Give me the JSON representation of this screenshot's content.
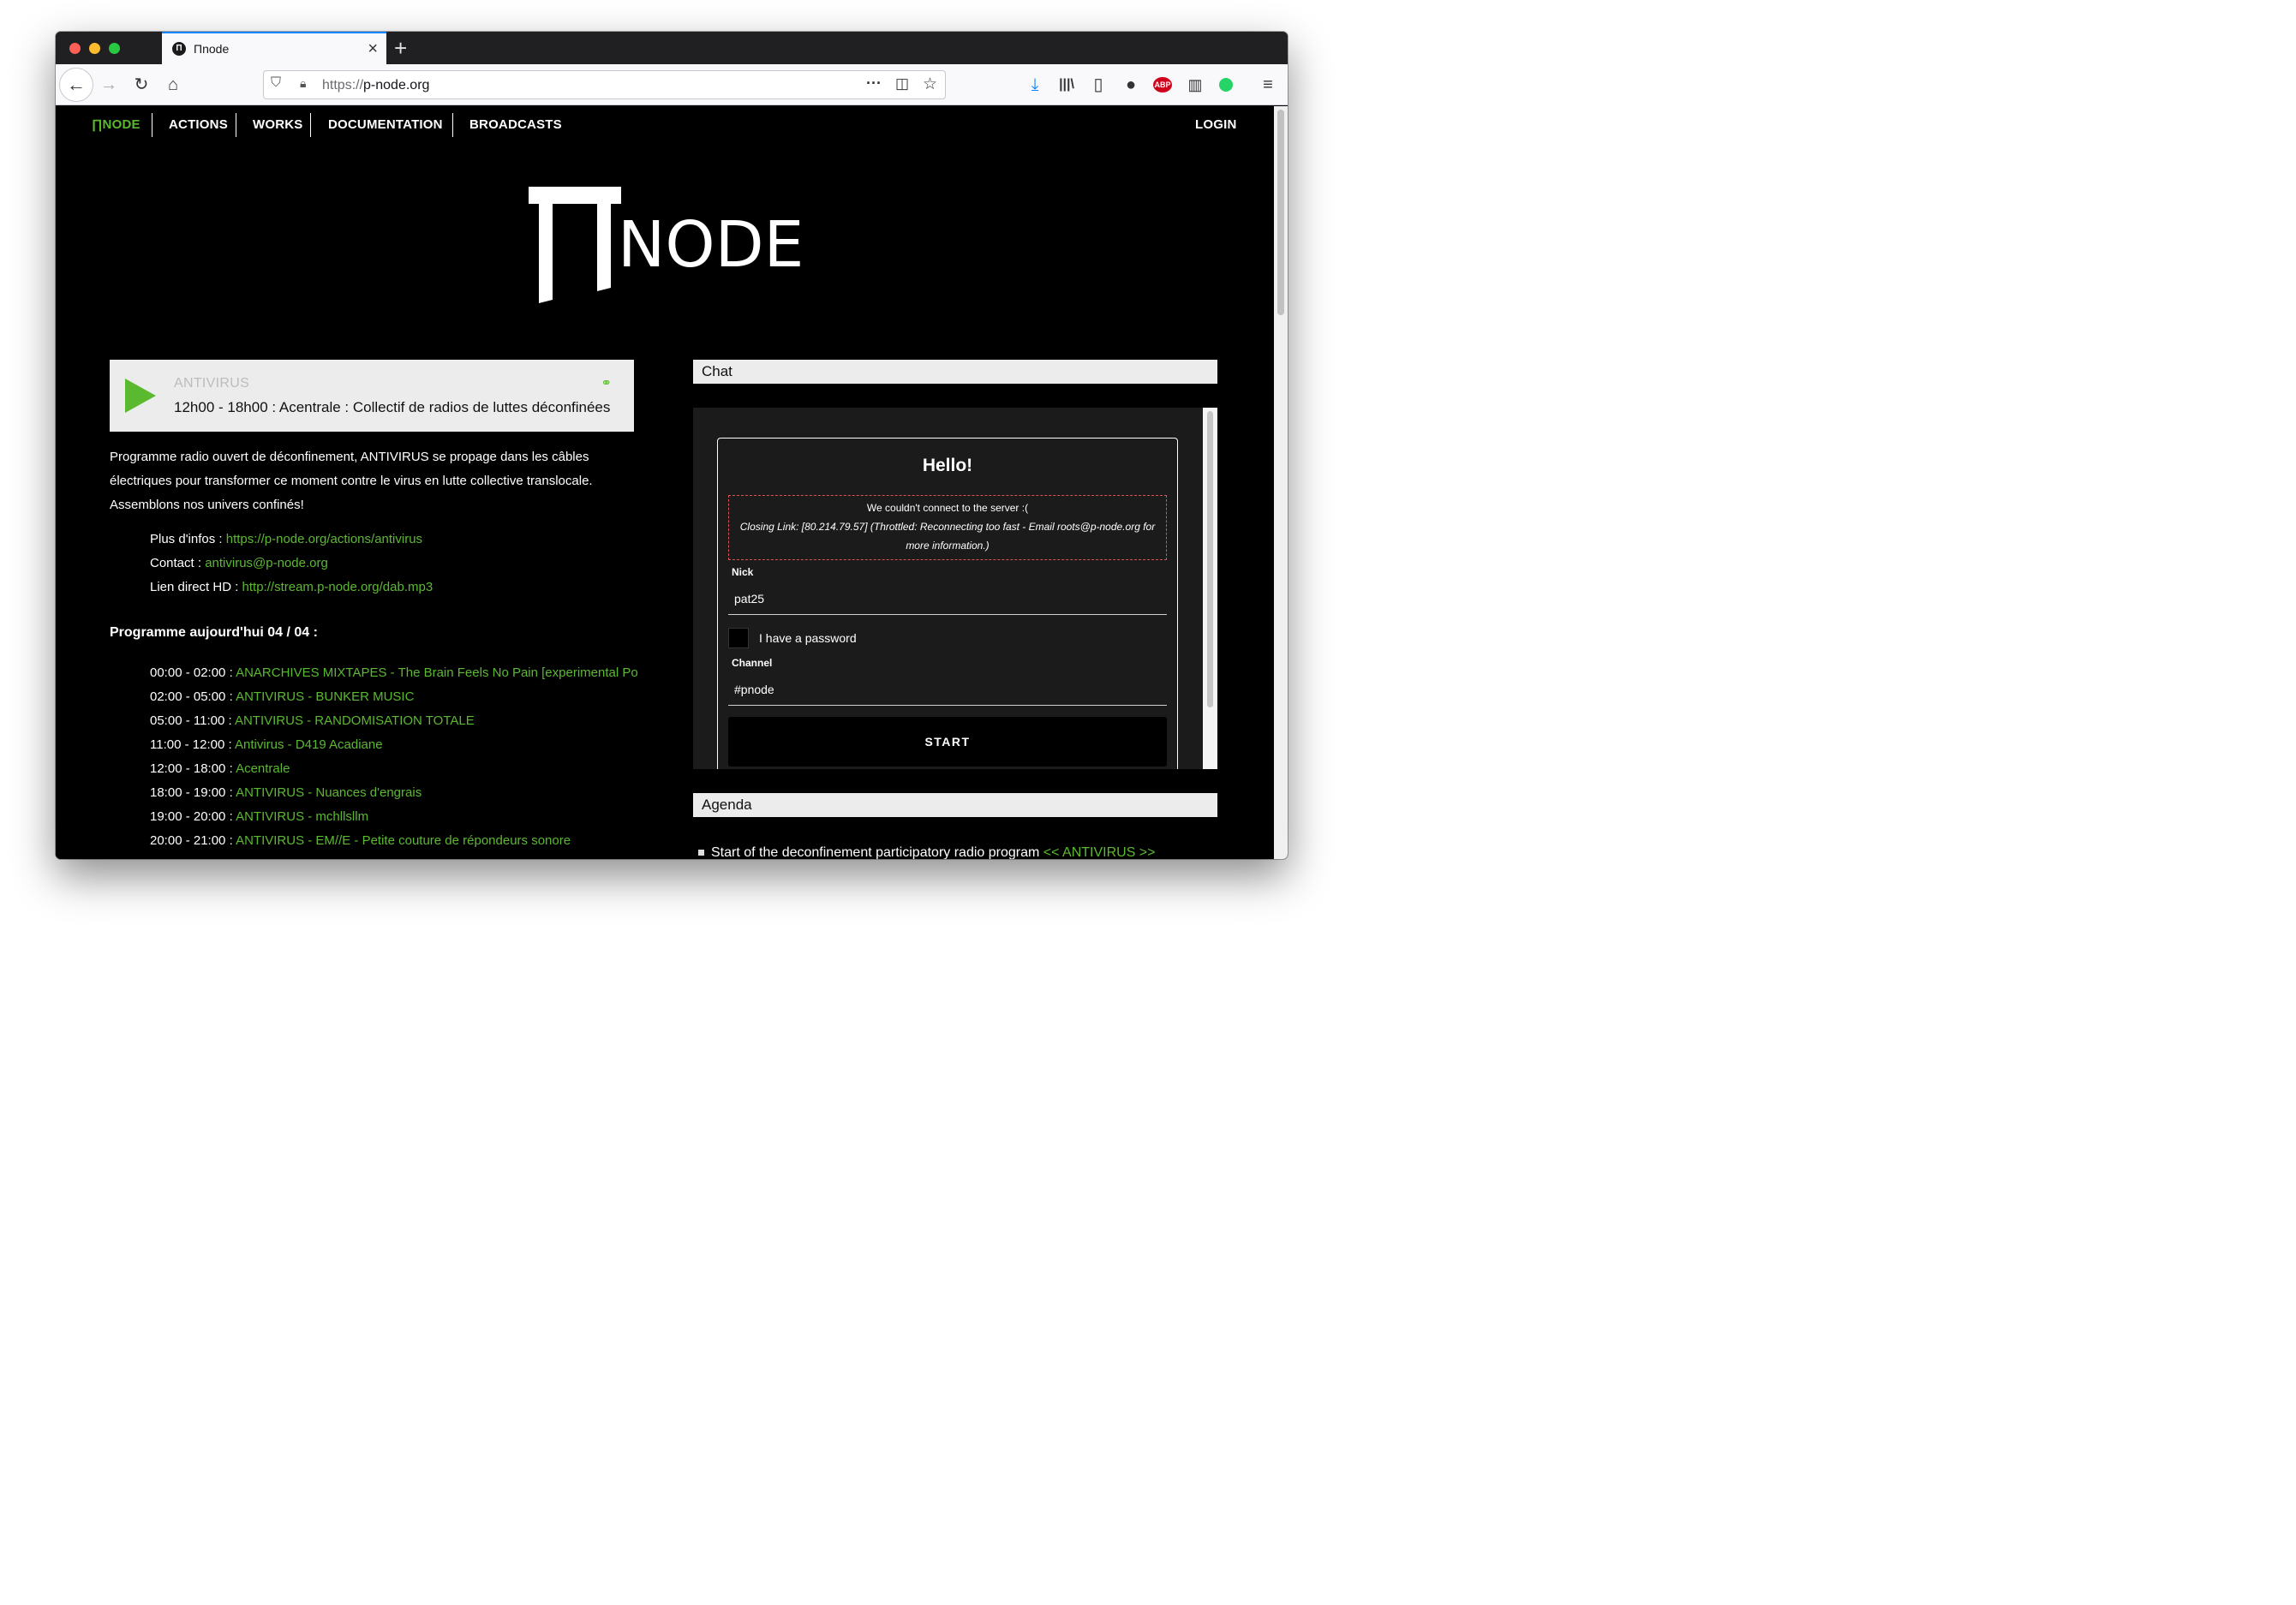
{
  "browser": {
    "tab_title": "Πnode",
    "tab_favicon": "Π",
    "url_protocol": "https://",
    "url_host": "p-node.org"
  },
  "nav": {
    "brand": "∏NODE",
    "items": [
      "ACTIONS",
      "WORKS",
      "DOCUMENTATION",
      "BROADCASTS"
    ],
    "login": "LOGIN"
  },
  "logo": {
    "text": "NODE"
  },
  "player": {
    "name": "ANTIVIRUS",
    "show": "12h00 - 18h00 :  Acentrale : Collectif de radios de luttes déconfinées"
  },
  "description": "Programme radio ouvert de déconfinement, ANTIVIRUS se propage dans les câbles électriques pour transformer ce moment contre le virus en lutte collective translocale. Assemblons nos univers confinés!",
  "info": [
    {
      "label": "Plus d'infos : ",
      "value": "https://p-node.org/actions/antivirus"
    },
    {
      "label": "Contact : ",
      "value": "antivirus@p-node.org"
    },
    {
      "label": "Lien direct HD : ",
      "value": "http://stream.p-node.org/dab.mp3"
    }
  ],
  "programme": {
    "title": "Programme aujourd'hui 04 / 04 :",
    "rows": [
      {
        "time": "00:00 - 02:00 : ",
        "show": "ANARCHIVES MIXTAPES - The Brain Feels No Pain [experimental Post-"
      },
      {
        "time": "02:00 - 05:00 : ",
        "show": "ANTIVIRUS - BUNKER MUSIC"
      },
      {
        "time": "05:00 - 11:00 : ",
        "show": "ANTIVIRUS - RANDOMISATION TOTALE"
      },
      {
        "time": "11:00 - 12:00 : ",
        "show": "Antivirus - D419 Acadiane"
      },
      {
        "time": "12:00 - 18:00 : ",
        "show": "Acentrale"
      },
      {
        "time": "18:00 - 19:00 : ",
        "show": "ANTIVIRUS - Nuances d'engrais"
      },
      {
        "time": "19:00 - 20:00 : ",
        "show": "ANTIVIRUS - mchllsllm"
      },
      {
        "time": "20:00 - 21:00 : ",
        "show": "ANTIVIRUS - EM//E - Petite couture de répondeurs sonore"
      }
    ]
  },
  "chat": {
    "heading": "Chat",
    "hello": "Hello!",
    "error_title": "We couldn't connect to the server :(",
    "error_detail": "Closing Link: [80.214.79.57] (Throttled: Reconnecting too fast - Email roots@p-node.org for more information.)",
    "nick_label": "Nick",
    "nick_value": "pat25",
    "password_label": "I have a password",
    "channel_label": "Channel",
    "channel_value": "#pnode",
    "start_label": "START"
  },
  "agenda": {
    "heading": "Agenda",
    "item_text": "Start of the deconfinement participatory radio program ",
    "item_link": "<< ANTIVIRUS >>"
  },
  "colors": {
    "accent_green": "#5bb930",
    "page_bg": "#000000",
    "section_bg": "#ececec"
  }
}
